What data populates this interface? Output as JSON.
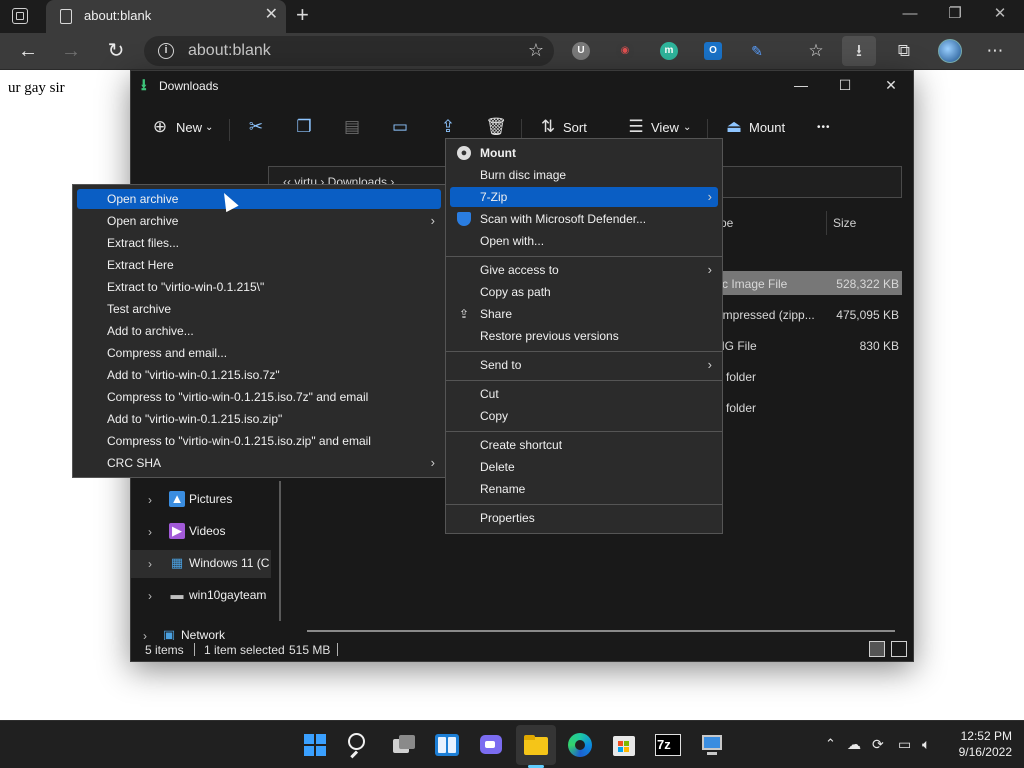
{
  "browser": {
    "tab": {
      "title": "about:blank",
      "close": "✕"
    },
    "new_tab": "+",
    "window_controls": {
      "minimize": "—",
      "restore": "❐",
      "close": "✕"
    },
    "nav": {
      "back": "←",
      "forward": "→",
      "refresh": "↻"
    },
    "address": {
      "info": "i",
      "text": "about:blank",
      "favorite_add": "☆"
    },
    "extensions": [
      {
        "name": "ublock",
        "letter": "U",
        "color": "#7a7a7a"
      },
      {
        "name": "glasses",
        "letter": "◉",
        "color": "#3a3a3a"
      },
      {
        "name": "m-extension",
        "letter": "m",
        "color": "#2fb59c"
      },
      {
        "name": "outlook",
        "letter": "O",
        "color": "#1a73c9"
      },
      {
        "name": "pen",
        "letter": "✎",
        "color": "#3b3b3b"
      }
    ],
    "toolbar_icons": {
      "favorites": "☆",
      "downloads": "⭳",
      "collections": "⧉",
      "more": "⋯"
    }
  },
  "page": {
    "text": "ur gay sir"
  },
  "explorer": {
    "title": "Downloads",
    "commands": {
      "new": "New",
      "sort": "Sort",
      "view": "View",
      "mount": "Mount",
      "more": "•••"
    },
    "address_text": "‹‹  virtu  ›  Downloads  ›",
    "columns": {
      "type": "pe",
      "size": "Size"
    },
    "files": [
      {
        "type": "sc Image File",
        "size": "528,322 KB"
      },
      {
        "type": "ompressed (zipp...",
        "size": "475,095 KB"
      },
      {
        "type": "NG File",
        "size": "830 KB"
      },
      {
        "type": "e folder",
        "size": ""
      },
      {
        "type": "e folder",
        "size": ""
      }
    ],
    "nav_items": [
      {
        "label": "Pictures",
        "icon_color": "#3a8de0"
      },
      {
        "label": "Videos",
        "icon_color": "#a25ad8"
      },
      {
        "label": "Windows 11 (C",
        "icon_color": "#4aa0e0"
      },
      {
        "label": "win10gayteam",
        "icon_color": "#bfbfbf"
      },
      {
        "label": "Network",
        "icon_color": "#4aa0e0"
      }
    ],
    "status": {
      "count": "5 items",
      "selected": "1 item selected",
      "size": "515 MB"
    }
  },
  "context_menu": {
    "items_group1": [
      {
        "label": "Mount",
        "bold": true,
        "icon": "disc"
      },
      {
        "label": "Burn disc image"
      },
      {
        "label": "7-Zip",
        "highlight": true,
        "submenu": true
      },
      {
        "label": "Scan with Microsoft Defender...",
        "icon": "shield"
      },
      {
        "label": "Open with..."
      }
    ],
    "items_group2": [
      {
        "label": "Give access to",
        "submenu": true
      },
      {
        "label": "Copy as path"
      },
      {
        "label": "Share",
        "icon": "share"
      },
      {
        "label": "Restore previous versions"
      }
    ],
    "items_group3": [
      {
        "label": "Send to",
        "submenu": true
      }
    ],
    "items_group4": [
      {
        "label": "Cut"
      },
      {
        "label": "Copy"
      }
    ],
    "items_group5": [
      {
        "label": "Create shortcut"
      },
      {
        "label": "Delete"
      },
      {
        "label": "Rename"
      }
    ],
    "items_group6": [
      {
        "label": "Properties"
      }
    ]
  },
  "sevenzip_menu": {
    "items": [
      {
        "label": "Open archive",
        "highlight": true
      },
      {
        "label": "Open archive",
        "submenu": true
      },
      {
        "label": "Extract files..."
      },
      {
        "label": "Extract Here"
      },
      {
        "label": "Extract to \"virtio-win-0.1.215\\\""
      },
      {
        "label": "Test archive"
      },
      {
        "label": "Add to archive..."
      },
      {
        "label": "Compress and email..."
      },
      {
        "label": "Add to \"virtio-win-0.1.215.iso.7z\""
      },
      {
        "label": "Compress to \"virtio-win-0.1.215.iso.7z\" and email"
      },
      {
        "label": "Add to \"virtio-win-0.1.215.iso.zip\""
      },
      {
        "label": "Compress to \"virtio-win-0.1.215.iso.zip\" and email"
      },
      {
        "label": "CRC SHA",
        "submenu": true
      }
    ]
  },
  "taskbar": {
    "sevenzip_label": "7z",
    "clock": {
      "time": "12:52 PM",
      "date": "9/16/2022"
    }
  },
  "colors": {
    "accent": "#0a5ec4",
    "explorer_bg": "#191919",
    "menu_bg": "#2b2b2b"
  }
}
